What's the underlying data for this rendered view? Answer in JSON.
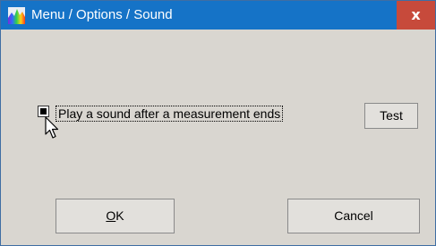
{
  "window": {
    "title": "Menu / Options / Sound",
    "close_label": "x",
    "app_icon": "spectrum-app-icon"
  },
  "options": {
    "play_sound": {
      "label": "Play a sound after a measurement ends",
      "checked": true
    },
    "test_button": "Test"
  },
  "footer": {
    "ok_label": "OK",
    "cancel_label": "Cancel"
  },
  "colors": {
    "titlebar": "#1573c7",
    "close_button": "#c74a3b",
    "dialog_background": "#d9d6d0"
  }
}
